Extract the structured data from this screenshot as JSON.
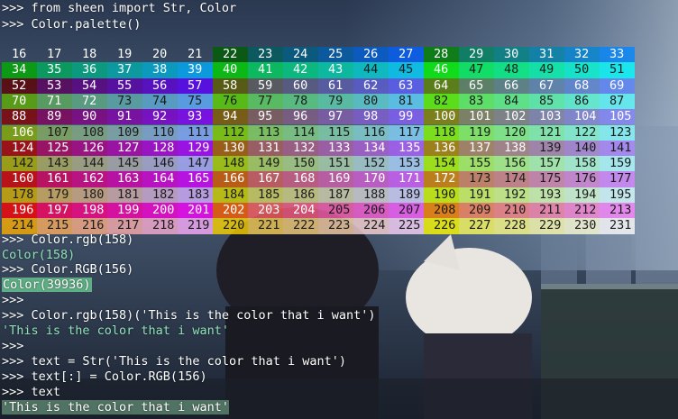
{
  "terminal": {
    "lines": [
      {
        "text": ">>> from sheen import Str, Color"
      },
      {
        "text": ">>> Color.palette()"
      },
      {
        "text": ">>> Color.rgb(158)"
      },
      {
        "text": "Color(158)"
      },
      {
        "text": ">>> Color.RGB(156)"
      },
      {
        "text": "Color(39936)"
      },
      {
        "text": ">>>"
      },
      {
        "text": ">>> Color.rgb(158)('This is the color that i want')"
      },
      {
        "text": "'This is the color that i want'"
      },
      {
        "text": ">>>"
      },
      {
        "text": ">>> text = Str('This is the color that i want')"
      },
      {
        "text": ">>> text[:] = Color.RGB(156)"
      },
      {
        "text": ">>> text"
      },
      {
        "text": "'This is the color that i want'"
      }
    ]
  },
  "palette": {
    "start": 16,
    "end": 231,
    "columns": 18
  },
  "colors": {
    "prompt_text": "#ffffff",
    "output_green": "#8fe3b9",
    "highlight_green": "#5fae85"
  }
}
